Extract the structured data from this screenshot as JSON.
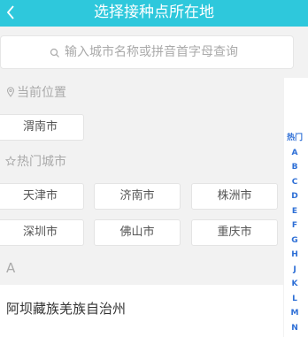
{
  "header": {
    "title": "选择接种点所在地"
  },
  "search": {
    "placeholder": "输入城市名称或拼音首字母查询"
  },
  "current_location": {
    "label": "当前位置",
    "city": "渭南市"
  },
  "hot_cities": {
    "label": "热门城市",
    "cities": [
      "天津市",
      "济南市",
      "株洲市",
      "深圳市",
      "佛山市",
      "重庆市"
    ]
  },
  "city_list": {
    "letter": "A",
    "items": [
      "阿坝藏族羌族自治州"
    ]
  },
  "index_bar": {
    "items": [
      "热门",
      "A",
      "B",
      "C",
      "D",
      "E",
      "F",
      "G",
      "H",
      "J",
      "K",
      "L",
      "M",
      "N"
    ]
  },
  "colors": {
    "accent": "#2ec8dc",
    "index": "#2e6fd6"
  }
}
